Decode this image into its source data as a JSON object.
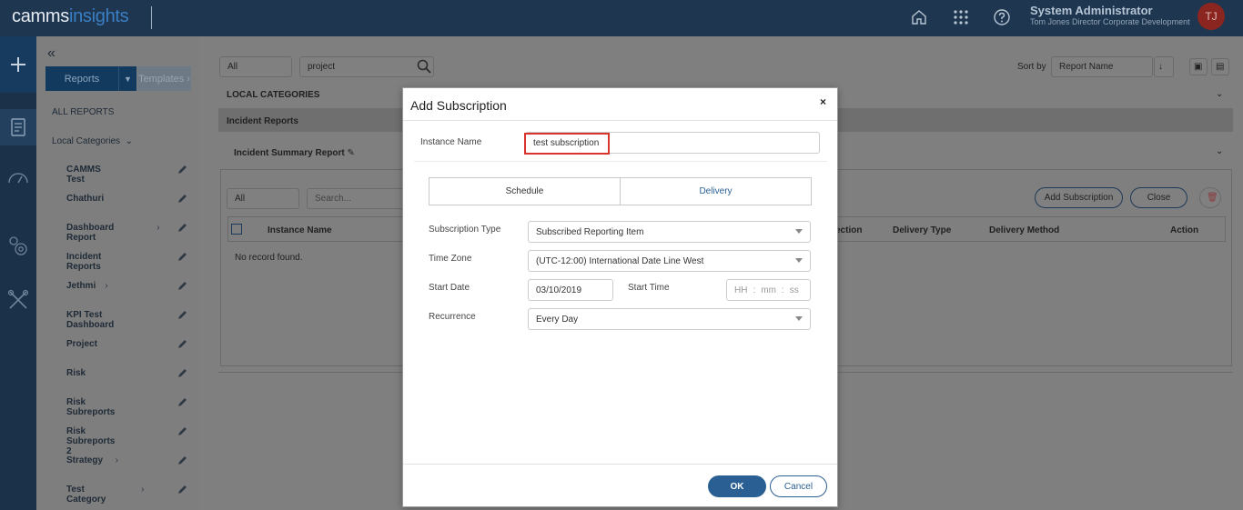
{
  "header": {
    "logo_part1": "camms",
    "logo_part2": "insights",
    "user_name": "System Administrator",
    "user_subtitle": "Tom Jones Director Corporate Development",
    "avatar_initials": "TJ"
  },
  "rail": {
    "icons": [
      "plus-icon",
      "report-icon",
      "dashboard-icon",
      "settings-icon",
      "tools-icon"
    ]
  },
  "sidebar": {
    "reports_label": "Reports",
    "templates_label": "Templates",
    "all_reports": "ALL REPORTS",
    "local_categories": "Local Categories",
    "items": [
      {
        "label": "CAMMS Test",
        "has_children": false
      },
      {
        "label": "Chathuri",
        "has_children": false
      },
      {
        "label": "Dashboard Report",
        "has_children": true
      },
      {
        "label": "Incident Reports",
        "has_children": false
      },
      {
        "label": "Jethmi",
        "has_children": true
      },
      {
        "label": "KPI Test Dashboard",
        "has_children": false
      },
      {
        "label": "Project",
        "has_children": false
      },
      {
        "label": "Risk",
        "has_children": false
      },
      {
        "label": "Risk Subreports",
        "has_children": false
      },
      {
        "label": "Risk Subreports 2",
        "has_children": false
      },
      {
        "label": "Strategy",
        "has_children": true
      },
      {
        "label": "Test Category",
        "has_children": true
      }
    ]
  },
  "main": {
    "filter_value": "All",
    "search_value": "project",
    "sort_label": "Sort by",
    "sort_value": "Report Name",
    "local_categories_header": "LOCAL CATEGORIES",
    "incident_reports_header": "Incident Reports",
    "report_name": "Incident Summary Report",
    "sub_filter_value": "All",
    "sub_search_placeholder": "Search...",
    "add_subscription_label": "Add Subscription",
    "close_label": "Close",
    "table_headers": {
      "instance_name": "Instance Name",
      "direction": "ection",
      "delivery_type": "Delivery Type",
      "delivery_method": "Delivery Method",
      "action": "Action"
    },
    "no_record": "No record found."
  },
  "modal": {
    "title": "Add Subscription",
    "close_glyph": "×",
    "instance_name_label": "Instance Name",
    "instance_name_value": "test subscription",
    "tabs": [
      "Schedule",
      "Delivery"
    ],
    "subscription_type_label": "Subscription Type",
    "subscription_type_value": "Subscribed Reporting Item",
    "time_zone_label": "Time Zone",
    "time_zone_value": "(UTC-12:00) International Date Line West",
    "start_date_label": "Start Date",
    "start_date_value": "03/10/2019",
    "start_time_label": "Start Time",
    "start_time_hh": "HH",
    "start_time_mm": "mm",
    "start_time_ss": "ss",
    "recurrence_label": "Recurrence",
    "recurrence_value": "Every Day",
    "ok_label": "OK",
    "cancel_label": "Cancel"
  }
}
